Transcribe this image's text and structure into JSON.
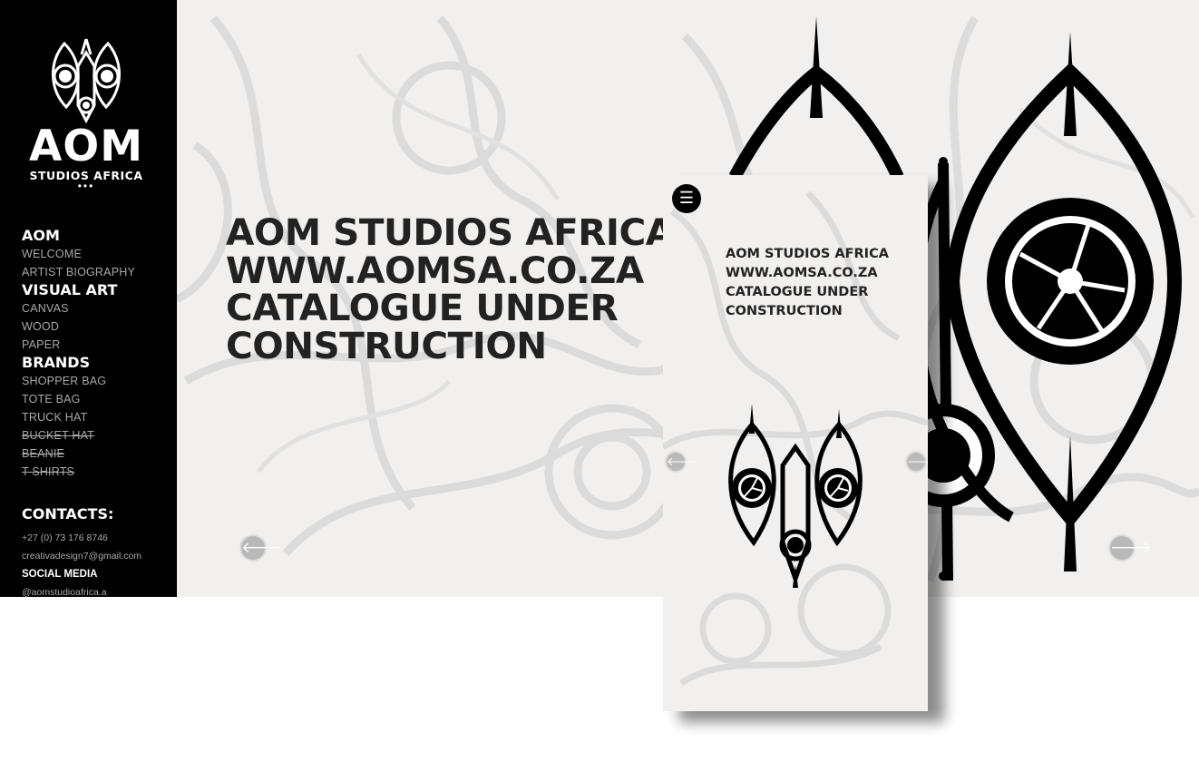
{
  "brand": {
    "name": "AOM",
    "subtitle": "STUDIOS AFRICA",
    "dots": "•••"
  },
  "nav": {
    "sections": [
      {
        "title": "AOM",
        "items": [
          {
            "label": "WELCOME",
            "struck": false
          },
          {
            "label": "ARTIST BIOGRAPHY",
            "struck": false
          }
        ]
      },
      {
        "title": "VISUAL ART",
        "items": [
          {
            "label": "CANVAS",
            "struck": false
          },
          {
            "label": "WOOD",
            "struck": false
          },
          {
            "label": "PAPER",
            "struck": false
          }
        ]
      },
      {
        "title": "BRANDS",
        "items": [
          {
            "label": "SHOPPER BAG",
            "struck": false
          },
          {
            "label": "TOTE BAG",
            "struck": false
          },
          {
            "label": "TRUCK HAT",
            "struck": false
          },
          {
            "label": "BUCKET HAT",
            "struck": true
          },
          {
            "label": "BEANIE",
            "struck": true
          },
          {
            "label": "T SHIRTS",
            "struck": true
          }
        ]
      }
    ]
  },
  "contacts": {
    "title": "CONTACTS:",
    "phone": "+27 (0) 73 176 8746",
    "email": "creativadesign7@gmail.com",
    "social_title": "SOCIAL MEDIA",
    "social_handle": "@aomstudioafrica.a"
  },
  "hero": {
    "lines": [
      "AOM STUDIOS AFRICA",
      "WWW.AOMSA.CO.ZA",
      "CATALOGUE UNDER",
      "CONSTRUCTION"
    ]
  },
  "mobile": {
    "lines": [
      "AOM STUDIOS AFRICA",
      "WWW.AOMSA.CO.ZA",
      "CATALOGUE UNDER",
      "CONSTRUCTION"
    ],
    "menu_icon": "☰"
  },
  "icons": {
    "prev": "🡐",
    "next": "🡒"
  },
  "colors": {
    "sidebar_bg": "#000000",
    "hero_bg": "#f1f0ef",
    "text_dark": "#222222",
    "nav_muted": "#a8a8a8"
  }
}
